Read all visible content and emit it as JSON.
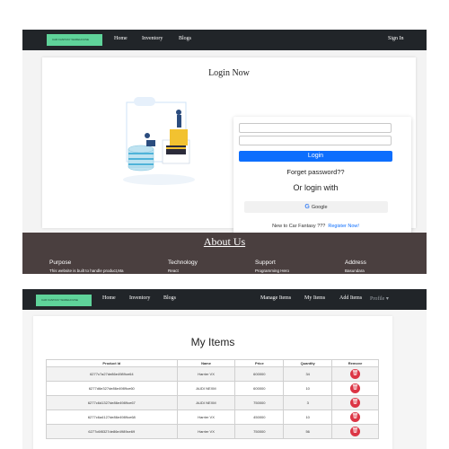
{
  "login_page": {
    "navbar": {
      "logo_text": "CAR FANTASY WAREHOUSE",
      "links": [
        "Home",
        "Inventory",
        "Blogs"
      ],
      "sign_in": "Sign In"
    },
    "title": "Login Now",
    "login_button": "Login",
    "forgot_password": "Forget password??",
    "or_login_with": "Or login with",
    "google_button": "Google",
    "new_user_text": "New to Car Fantasy ???",
    "register_link": "Register Now!",
    "about": {
      "title": "About Us",
      "columns": [
        {
          "heading": "Purpose",
          "text": "This website is built to handle product,Ma"
        },
        {
          "heading": "Technology",
          "text": "React"
        },
        {
          "heading": "Support",
          "text": "Programming Hero"
        },
        {
          "heading": "Address",
          "text": "Basundara"
        }
      ]
    }
  },
  "items_page": {
    "navbar": {
      "logo_text": "CAR FANTASY WAREHOUSE",
      "links": [
        "Home",
        "Inventory",
        "Blogs"
      ],
      "right_links": [
        "Manage Items",
        "My Items",
        "Add Items"
      ],
      "profile": "Profile ▾"
    },
    "title": "My Items",
    "table": {
      "headers": [
        "Product Id",
        "Name",
        "Price",
        "Quantity",
        "Remove"
      ],
      "rows": [
        [
          "6277c7a27de86e4989ce64",
          "Harrier VX",
          "600000",
          "34"
        ],
        [
          "6277d6e327de86e4989ce60",
          "AUDI NEXM",
          "600000",
          "10"
        ],
        [
          "6277c6d1327de86e4989ce67",
          "AUDI NEXM",
          "750000",
          "3"
        ],
        [
          "6277c6a4127de86e4989ce68",
          "Harrier VX",
          "450000",
          "10"
        ],
        [
          "6277c6f8327de86e4989ce69",
          "Harrier VX",
          "750000",
          "56"
        ]
      ]
    },
    "colors": {
      "remove_button": "#dc3545",
      "nav_bg": "#212529",
      "logo_bg": "#5fd39a"
    }
  }
}
